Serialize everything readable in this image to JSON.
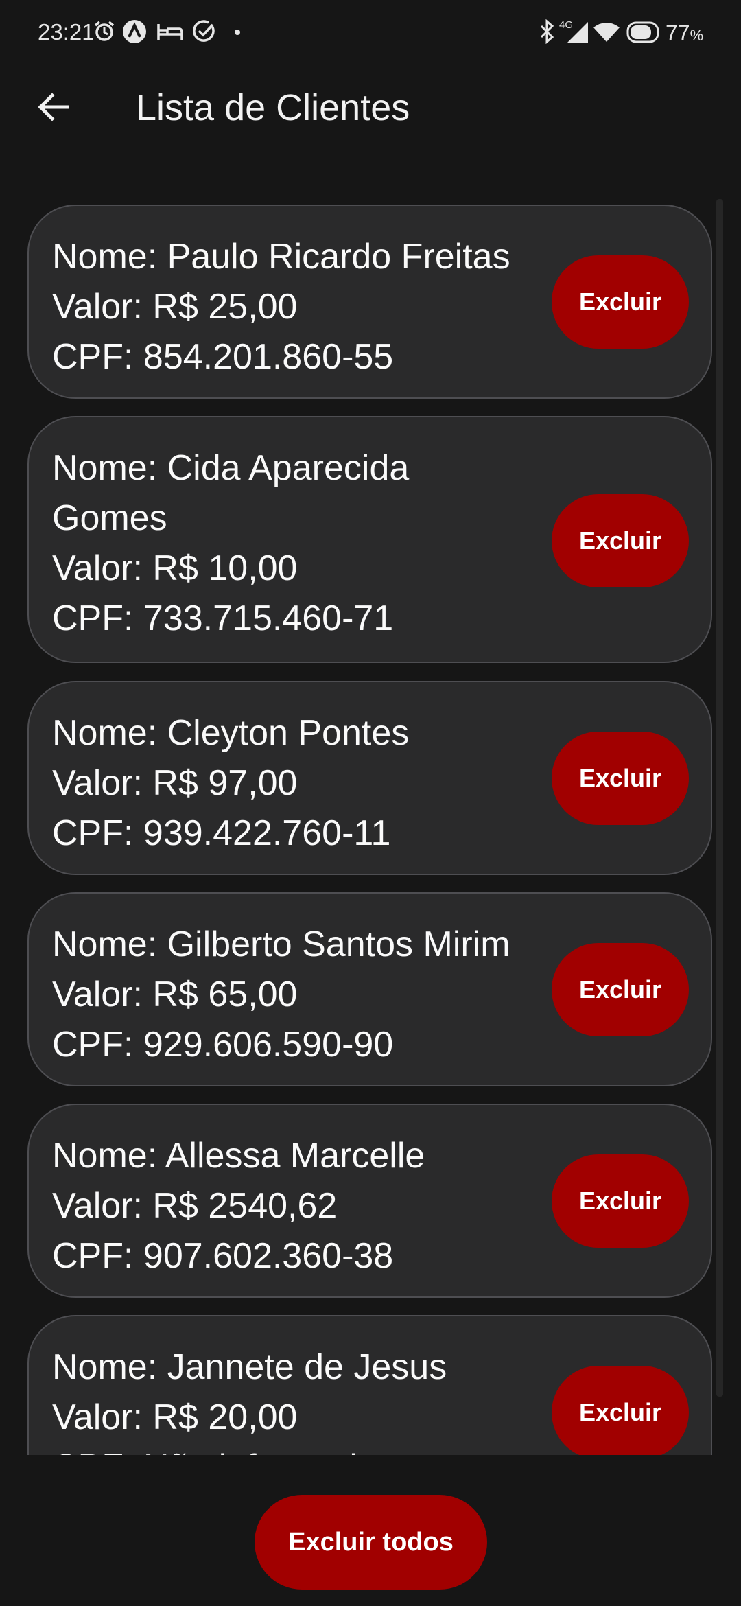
{
  "status_bar": {
    "time": "23:21",
    "network": "4G",
    "battery_percent": "77",
    "battery_unit": "%",
    "icons": [
      "alarm-icon",
      "app-logo-icon",
      "bed-icon",
      "check-circle-icon",
      "dot-icon",
      "bluetooth-icon",
      "signal-icon",
      "wifi-icon",
      "battery-icon"
    ]
  },
  "app_bar": {
    "title": "Lista de Clientes",
    "back_icon": "arrow-left-icon"
  },
  "clients": [
    {
      "nome": "Nome: Paulo Ricardo Freitas",
      "valor": "Valor: R$ 25,00",
      "cpf": "CPF: 854.201.860-55",
      "delete_label": "Excluir"
    },
    {
      "nome": "Nome: Cida Aparecida Gomes",
      "valor": "Valor: R$ 10,00",
      "cpf": "CPF: 733.715.460-71",
      "delete_label": "Excluir"
    },
    {
      "nome": "Nome: Cleyton Pontes",
      "valor": "Valor: R$ 97,00",
      "cpf": "CPF: 939.422.760-11",
      "delete_label": "Excluir"
    },
    {
      "nome": "Nome: Gilberto Santos Mirim",
      "valor": "Valor: R$ 65,00",
      "cpf": "CPF: 929.606.590-90",
      "delete_label": "Excluir"
    },
    {
      "nome": "Nome: Allessa Marcelle",
      "valor": "Valor: R$ 2540,62",
      "cpf": "CPF: 907.602.360-38",
      "delete_label": "Excluir"
    },
    {
      "nome": "Nome: Jannete de Jesus",
      "valor": "Valor: R$ 20,00",
      "cpf": "CPF: Não informado",
      "delete_label": "Excluir"
    }
  ],
  "footer": {
    "delete_all_label": "Excluir todos"
  },
  "colors": {
    "background": "#161616",
    "card": "#2a2a2b",
    "card_border": "#4e4e52",
    "danger": "#a10000"
  }
}
